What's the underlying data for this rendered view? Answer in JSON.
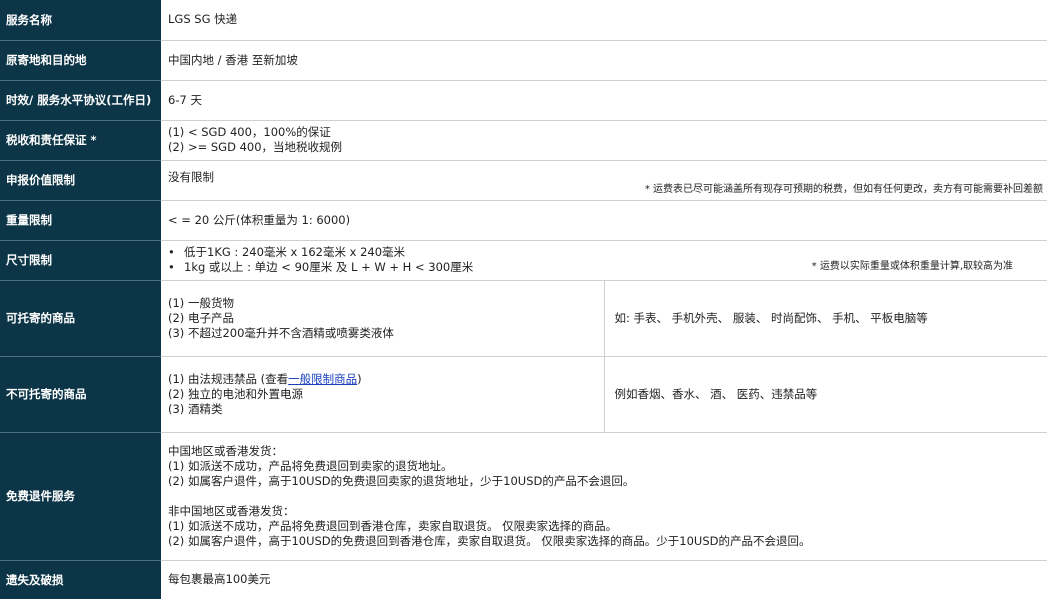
{
  "rows": {
    "service": {
      "label": "服务名称",
      "value": "LGS SG 快递"
    },
    "route": {
      "label": "原寄地和目的地",
      "value": "中国内地 / 香港 至新加坡"
    },
    "sla": {
      "label": "时效/ 服务水平协议(工作日)",
      "value": "6-7 天"
    },
    "tax": {
      "label": "税收和责任保证 *",
      "line1": "(1) < SGD 400，100%的保证",
      "line2": "(2) >= SGD 400，当地税收规例"
    },
    "declared": {
      "label": "申报价值限制",
      "value": "没有限制",
      "note": "* 运费表已尽可能涵盖所有现存可预期的税费，但如有任何更改，卖方有可能需要补回差额"
    },
    "weight": {
      "label": "重量限制",
      "value": "< = 20 公斤(体积重量为 1: 6000)"
    },
    "size": {
      "label": "尺寸限制",
      "line1": "低于1KG : 240毫米 x 162毫米 x 240毫米",
      "line2": "1kg 或以上 : 单边 < 90厘米 及 L + W + H < 300厘米",
      "note": "* 运费以实际重量或体积重量计算,取较高为准"
    },
    "allowed": {
      "label": "可托寄的商品",
      "line1": "(1) 一般货物",
      "line2": "(2) 电子产品",
      "line3": "(3) 不超过200毫升并不含酒精或喷雾类液体",
      "examples": "如: 手表、 手机外壳、 服装、 时尚配饰、 手机、 平板电脑等"
    },
    "prohibited": {
      "label": "不可托寄的商品",
      "line1_prefix": "(1) 由法规违禁品 (查看",
      "line1_link": "一般限制商品",
      "line1_suffix": ")",
      "line2": "(2) 独立的电池和外置电源",
      "line3": "(3) 酒精类",
      "examples": "例如香烟、香水、 酒、 医药、违禁品等"
    },
    "returns": {
      "label": "免费退件服务",
      "cn_title": "中国地区或香港发货：",
      "cn_1": "(1)  如派送不成功，产品将免费退回到卖家的退货地址。",
      "cn_2": "(2)  如属客户退件，高于10USD的免费退回卖家的退货地址，少于10USD的产品不会退回。",
      "other_title": "非中国地区或香港发货：",
      "other_1": "(1)  如派送不成功，产品将免费退回到香港仓库，卖家自取退货。 仅限卖家选择的商品。",
      "other_2": "(2)  如属客户退件，高于10USD的免费退回到香港仓库，卖家自取退货。 仅限卖家选择的商品。少于10USD的产品不会退回。"
    },
    "loss": {
      "label": "遗失及破损",
      "value": "每包裹最高100美元"
    }
  }
}
